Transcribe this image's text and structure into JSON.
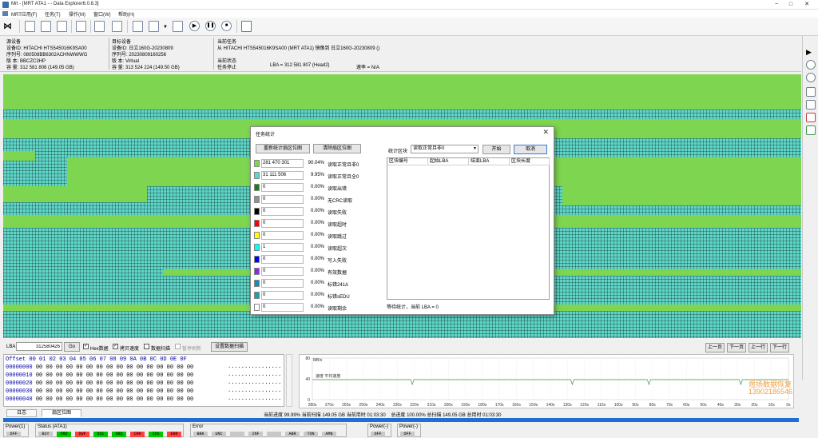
{
  "window": {
    "title": "Mrt - [MRT ATA1 - - Data Explorer6.0.8.3]",
    "min": "−",
    "max": "□",
    "close": "✕"
  },
  "menu": [
    "MRT应用(F)",
    "任务(T)",
    "操作(M)",
    "窗口(W)",
    "帮助(H)"
  ],
  "source": {
    "heading": "源设备",
    "id": "设备ID: HITACHI HTS545016K9SA00",
    "serial": "序列号: 080508BB6302ACHNWWWG",
    "version": "版    本: BBCZC3HP",
    "capacity": "容    量: 312 581 808 (149.05 GB)"
  },
  "target": {
    "heading": "目标设备",
    "id": "设备ID: 日立160G-20230809",
    "serial": "序列号: 20230809160256",
    "version": "版    本: Virtual",
    "capacity": "容    量: 313 524 224 (149.50 GB)"
  },
  "task": {
    "heading": "当前任务",
    "desc": "从 HITACHI HTS545016K9SA00 (MRT ATA1) 镜像到 日立160G-20230809 ()",
    "state_heading": "当前状态",
    "state": "任务停止",
    "lba": "LBA = 312 581 807 (Head2)",
    "speed": "速率 = N/A"
  },
  "dialog": {
    "title": "任务统计",
    "btn_refresh": "重新统计扇区位图",
    "btn_clear": "清除扇区位图",
    "block_label": "统计区块",
    "block_value": "读取正常且非0",
    "btn_start": "开始",
    "btn_cancel": "取消",
    "legend": [
      {
        "color": "#7ed650",
        "count": "281 470 301",
        "pct": "90.04%",
        "label": "读取正常且非0"
      },
      {
        "color": "#5ed6c8",
        "count": "31 111 506",
        "pct": "9.95%",
        "label": "读取正常且全0"
      },
      {
        "color": "#1e7a1e",
        "count": "0",
        "pct": "0.00%",
        "label": "读取出错"
      },
      {
        "color": "#909090",
        "count": "0",
        "pct": "0.00%",
        "label": "无CRC读取"
      },
      {
        "color": "#000000",
        "count": "0",
        "pct": "0.00%",
        "label": "读取失败"
      },
      {
        "color": "#ff0000",
        "count": "0",
        "pct": "0.00%",
        "label": "读取超时"
      },
      {
        "color": "#ffff00",
        "count": "0",
        "pct": "0.00%",
        "label": "读取跳过"
      },
      {
        "color": "#00ffff",
        "count": "1",
        "pct": "0.00%",
        "label": "读取超次"
      },
      {
        "color": "#0000ff",
        "count": "0",
        "pct": "0.00%",
        "label": "写入失败"
      },
      {
        "color": "#8a2be2",
        "count": "0",
        "pct": "0.00%",
        "label": "有效数据"
      },
      {
        "color": "#1e8ab4",
        "count": "0",
        "pct": "0.00%",
        "label": "标错241A"
      },
      {
        "color": "#20a0a0",
        "count": "0",
        "pct": "0.00%",
        "label": "标错sEDU"
      },
      {
        "color": "#ffffff",
        "count": "0",
        "pct": "0.00%",
        "label": "读取剩余"
      }
    ],
    "table_headers": [
      "区块编号",
      "起始LBA",
      "结束LBA",
      "区块长度"
    ],
    "status": "等待统计，当前 LBA = 0"
  },
  "lba_bar": {
    "label": "LBA",
    "value": "312580426",
    "go": "Go",
    "hex_label": "Hex数据",
    "copy_label": "拷贝速度",
    "scan_label": "数据扫描",
    "refresh_label": "暂停刷新",
    "set_scan": "设置数据扫描",
    "nav": [
      "上一页",
      "下一页",
      "上一行",
      "下一行"
    ]
  },
  "hex": {
    "header": "Offset   00 01 02 03 04 05 06 07 08 09 0A 0B 0C 0D 0E 0F",
    "rows": [
      {
        "offset": "00000000",
        "bytes": "00 00 00 00 00 00 00 00 00 00 00 00 00 00 00 00",
        "ascii": "................"
      },
      {
        "offset": "00000010",
        "bytes": "00 00 00 00 00 00 00 00 00 00 00 00 00 00 00 00",
        "ascii": "................"
      },
      {
        "offset": "00000020",
        "bytes": "00 00 00 00 00 00 00 00 00 00 00 00 00 00 00 00",
        "ascii": "................"
      },
      {
        "offset": "00000030",
        "bytes": "00 00 00 00 00 00 00 00 00 00 00 00 00 00 00 00",
        "ascii": "................"
      },
      {
        "offset": "00000040",
        "bytes": "00 00 00 00 00 00 00 00 00 00 00 00 00 00 00 00",
        "ascii": "................"
      }
    ]
  },
  "speed_chart": {
    "unit": "MB/s",
    "y_ticks": [
      "80",
      "40",
      "0"
    ],
    "x_ticks": [
      "280s",
      "270s",
      "260s",
      "250s",
      "240s",
      "230s",
      "220s",
      "210s",
      "200s",
      "190s",
      "180s",
      "170s",
      "160s",
      "150s",
      "140s",
      "130s",
      "120s",
      "110s",
      "100s",
      "90s",
      "80s",
      "70s",
      "60s",
      "50s",
      "40s",
      "30s",
      "20s",
      "10s",
      "0s"
    ],
    "legend": "速度 平均速度",
    "watermark_1": "煜扬数据恢复",
    "watermark_2": "13902186546"
  },
  "tabs": [
    "日志",
    "扇区位图"
  ],
  "summary": "当前进度 99.99% 当前扫描 149.05 GB 当前用时 01:03:30    总进度 100.00% 总扫描 149.05 GB 总用时 01:03:30",
  "status_groups": [
    {
      "title": "Power(1)",
      "tags": [
        {
          "t": "OFF",
          "c": "#c8c8c8"
        }
      ]
    },
    {
      "title": "Status (ATA1)",
      "tags": [
        {
          "t": "BSY",
          "c": "#c8c8c8"
        },
        {
          "t": "DRD",
          "c": "#00c800"
        },
        {
          "t": "DWF",
          "c": "#ff4040"
        },
        {
          "t": "DSC",
          "c": "#00c800"
        },
        {
          "t": "DRQ",
          "c": "#00c800"
        },
        {
          "t": "CRR",
          "c": "#ff4040"
        },
        {
          "t": "IDX",
          "c": "#00c800"
        },
        {
          "t": "ERR",
          "c": "#ff4040"
        }
      ]
    },
    {
      "title": "Error",
      "tags": [
        {
          "t": "BBK",
          "c": "#c8c8c8"
        },
        {
          "t": "UNC",
          "c": "#c8c8c8"
        },
        {
          "t": "",
          "c": "#c8c8c8"
        },
        {
          "t": "INF",
          "c": "#c8c8c8"
        },
        {
          "t": "",
          "c": "#c8c8c8"
        },
        {
          "t": "ABR",
          "c": "#c8c8c8"
        },
        {
          "t": "TON",
          "c": "#c8c8c8"
        },
        {
          "t": "AMN",
          "c": "#c8c8c8"
        }
      ]
    },
    {
      "title": "Power(-)",
      "tags": [
        {
          "t": "OFF",
          "c": "#c8c8c8"
        }
      ]
    },
    {
      "title": "Power(-)",
      "tags": [
        {
          "t": "OFF",
          "c": "#c8c8c8"
        }
      ]
    }
  ]
}
